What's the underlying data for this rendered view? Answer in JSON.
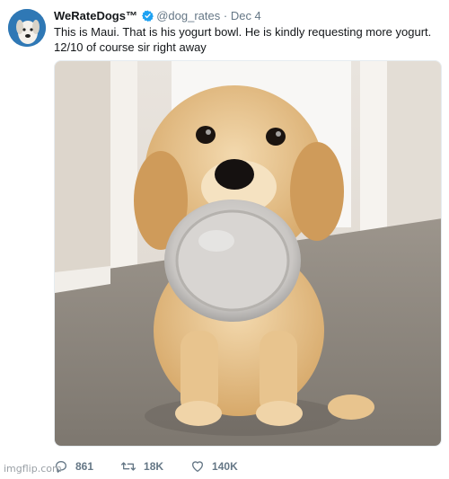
{
  "tweet": {
    "display_name": "WeRateDogs™",
    "handle": "@dog_rates",
    "separator": "·",
    "date": "Dec 4",
    "text": "This is Maui. That is his yogurt bowl. He is kindly requesting more yogurt. 12/10 of course sir right away",
    "avatar_icon": "dog-avatar-icon",
    "verified_icon": "verified-badge-icon",
    "media_alt": "golden retriever puppy holding a plastic bowl in its mouth"
  },
  "actions": {
    "replies": "861",
    "retweets": "18K",
    "likes": "140K",
    "reply_icon": "reply-icon",
    "retweet_icon": "retweet-icon",
    "like_icon": "heart-icon"
  },
  "watermark": "imgflip.com",
  "colors": {
    "text": "#14171a",
    "secondary": "#657786",
    "verified": "#1da1f2"
  }
}
